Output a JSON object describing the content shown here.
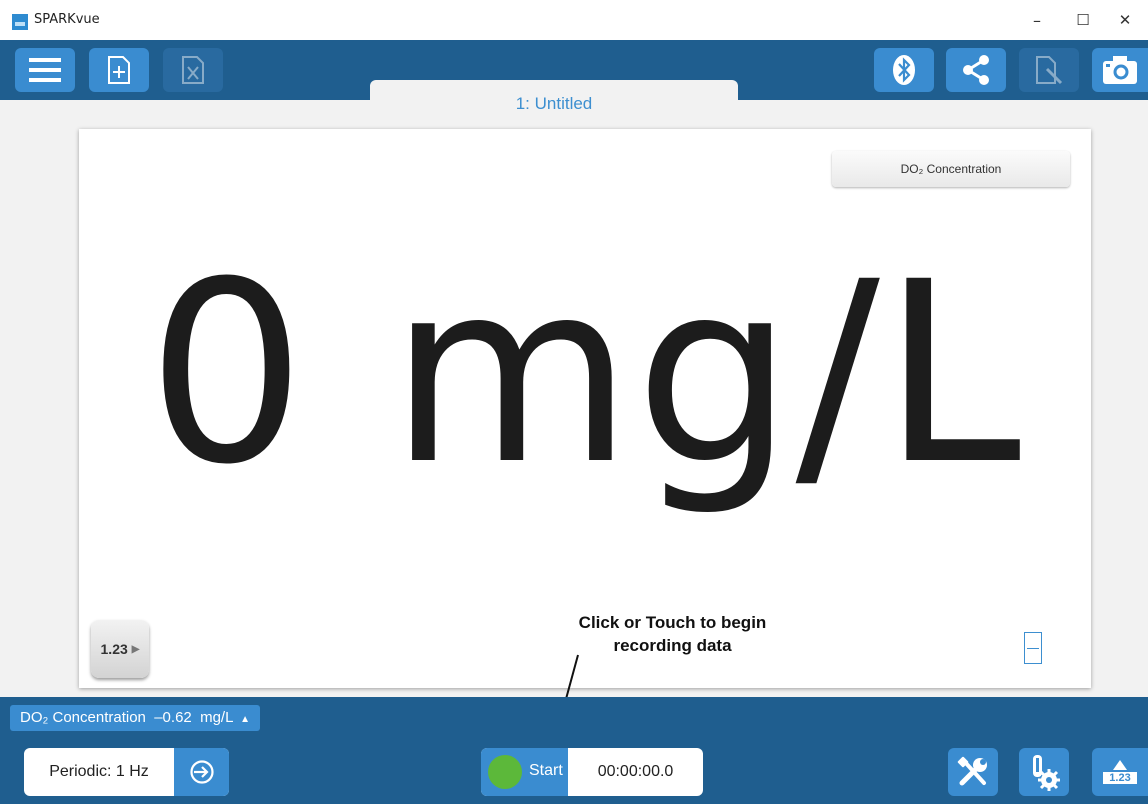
{
  "window": {
    "title": "SPARKvue",
    "minimize_glyph": "–",
    "maximize_glyph": "☐",
    "close_glyph": "✕"
  },
  "toolbar": {
    "left_icons": [
      "menu-icon",
      "new-page-icon",
      "delete-page-icon"
    ],
    "right_icons": [
      "bluetooth-icon",
      "share-icon",
      "annotate-icon",
      "camera-icon"
    ]
  },
  "tab": {
    "label": "1: Untitled"
  },
  "display": {
    "measurement_label": "DO₂ Concentration",
    "reading": "0 mg/L",
    "digits_button_label": "1.23",
    "digits_arrow": "▶"
  },
  "annotation": {
    "line1": "Click or Touch to begin",
    "line2": "recording data"
  },
  "sensor_bar": {
    "live_value": "DO₂ Concentration  –0.62  mg/L",
    "expand_glyph": "▲"
  },
  "controls": {
    "sampling_rate": "Periodic: 1 Hz",
    "start_label": "Start",
    "timer": "00:00:00.0",
    "data_digits_label": "1.23"
  },
  "colors": {
    "toolbar": "#1f5e8f",
    "button": "#3a8cd0",
    "accent": "#3d8fd0",
    "start_dot": "#5cb83a"
  }
}
